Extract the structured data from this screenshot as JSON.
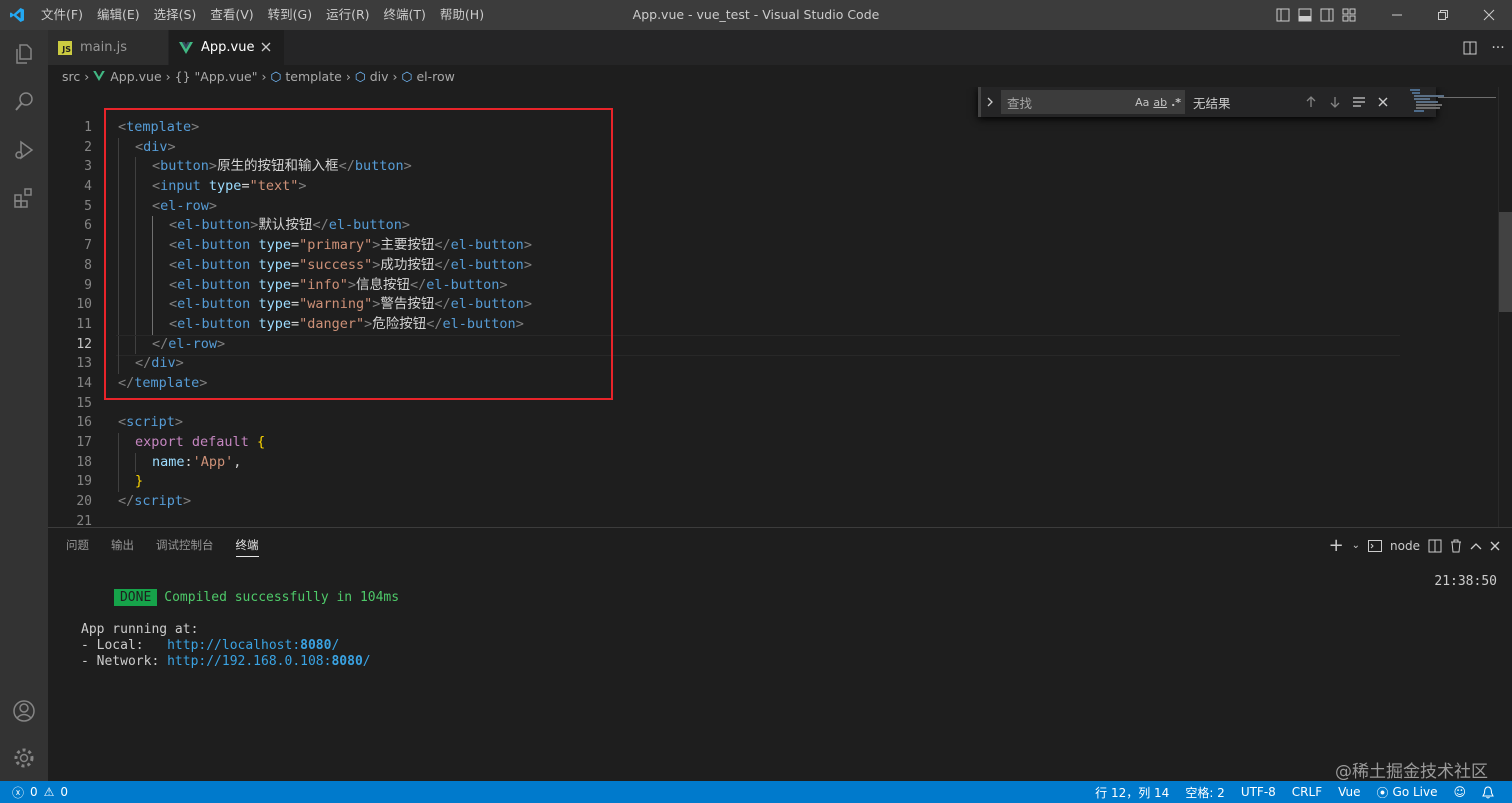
{
  "window": {
    "title": "App.vue - vue_test - Visual Studio Code",
    "menu": [
      "文件(F)",
      "编辑(E)",
      "选择(S)",
      "查看(V)",
      "转到(G)",
      "运行(R)",
      "终端(T)",
      "帮助(H)"
    ]
  },
  "tabs": [
    {
      "label": "main.js",
      "icon": "js-file-icon",
      "icon_text": "JS"
    },
    {
      "label": "App.vue",
      "icon": "vue-file-icon"
    }
  ],
  "breadcrumb": [
    "src",
    "App.vue",
    "{} \"App.vue\"",
    "template",
    "div",
    "el-row"
  ],
  "find": {
    "placeholder": "查找",
    "opt_case": "Aa",
    "opt_word": "ab",
    "opt_regex": ".*",
    "result": "无结果"
  },
  "editor": {
    "current_line": 12,
    "lines": [
      {
        "n": "1",
        "indent": 0,
        "tokens": [
          [
            "br",
            "<"
          ],
          [
            "tag",
            "template"
          ],
          [
            "br",
            ">"
          ]
        ]
      },
      {
        "n": "2",
        "indent": 1,
        "tokens": [
          [
            "br",
            "<"
          ],
          [
            "tag",
            "div"
          ],
          [
            "br",
            ">"
          ]
        ]
      },
      {
        "n": "3",
        "indent": 2,
        "tokens": [
          [
            "br",
            "<"
          ],
          [
            "tag",
            "button"
          ],
          [
            "br",
            ">"
          ],
          [
            "txt",
            "原生的按钮和输入框"
          ],
          [
            "br",
            "</"
          ],
          [
            "tag",
            "button"
          ],
          [
            "br",
            ">"
          ]
        ]
      },
      {
        "n": "4",
        "indent": 2,
        "tokens": [
          [
            "br",
            "<"
          ],
          [
            "tag",
            "input"
          ],
          [
            "txt",
            " "
          ],
          [
            "attr",
            "type"
          ],
          [
            "txt",
            "="
          ],
          [
            "str",
            "\"text\""
          ],
          [
            "br",
            ">"
          ]
        ]
      },
      {
        "n": "5",
        "indent": 2,
        "tokens": [
          [
            "br",
            "<"
          ],
          [
            "tag",
            "el-row"
          ],
          [
            "br",
            ">"
          ]
        ]
      },
      {
        "n": "6",
        "indent": 3,
        "tokens": [
          [
            "br",
            "<"
          ],
          [
            "tag",
            "el-button"
          ],
          [
            "br",
            ">"
          ],
          [
            "txt",
            "默认按钮"
          ],
          [
            "br",
            "</"
          ],
          [
            "tag",
            "el-button"
          ],
          [
            "br",
            ">"
          ]
        ]
      },
      {
        "n": "7",
        "indent": 3,
        "tokens": [
          [
            "br",
            "<"
          ],
          [
            "tag",
            "el-button"
          ],
          [
            "txt",
            " "
          ],
          [
            "attr",
            "type"
          ],
          [
            "txt",
            "="
          ],
          [
            "str",
            "\"primary\""
          ],
          [
            "br",
            ">"
          ],
          [
            "txt",
            "主要按钮"
          ],
          [
            "br",
            "</"
          ],
          [
            "tag",
            "el-button"
          ],
          [
            "br",
            ">"
          ]
        ]
      },
      {
        "n": "8",
        "indent": 3,
        "tokens": [
          [
            "br",
            "<"
          ],
          [
            "tag",
            "el-button"
          ],
          [
            "txt",
            " "
          ],
          [
            "attr",
            "type"
          ],
          [
            "txt",
            "="
          ],
          [
            "str",
            "\"success\""
          ],
          [
            "br",
            ">"
          ],
          [
            "txt",
            "成功按钮"
          ],
          [
            "br",
            "</"
          ],
          [
            "tag",
            "el-button"
          ],
          [
            "br",
            ">"
          ]
        ]
      },
      {
        "n": "9",
        "indent": 3,
        "tokens": [
          [
            "br",
            "<"
          ],
          [
            "tag",
            "el-button"
          ],
          [
            "txt",
            " "
          ],
          [
            "attr",
            "type"
          ],
          [
            "txt",
            "="
          ],
          [
            "str",
            "\"info\""
          ],
          [
            "br",
            ">"
          ],
          [
            "txt",
            "信息按钮"
          ],
          [
            "br",
            "</"
          ],
          [
            "tag",
            "el-button"
          ],
          [
            "br",
            ">"
          ]
        ]
      },
      {
        "n": "10",
        "indent": 3,
        "tokens": [
          [
            "br",
            "<"
          ],
          [
            "tag",
            "el-button"
          ],
          [
            "txt",
            " "
          ],
          [
            "attr",
            "type"
          ],
          [
            "txt",
            "="
          ],
          [
            "str",
            "\"warning\""
          ],
          [
            "br",
            ">"
          ],
          [
            "txt",
            "警告按钮"
          ],
          [
            "br",
            "</"
          ],
          [
            "tag",
            "el-button"
          ],
          [
            "br",
            ">"
          ]
        ]
      },
      {
        "n": "11",
        "indent": 3,
        "tokens": [
          [
            "br",
            "<"
          ],
          [
            "tag",
            "el-button"
          ],
          [
            "txt",
            " "
          ],
          [
            "attr",
            "type"
          ],
          [
            "txt",
            "="
          ],
          [
            "str",
            "\"danger\""
          ],
          [
            "br",
            ">"
          ],
          [
            "txt",
            "危险按钮"
          ],
          [
            "br",
            "</"
          ],
          [
            "tag",
            "el-button"
          ],
          [
            "br",
            ">"
          ]
        ]
      },
      {
        "n": "12",
        "indent": 2,
        "tokens": [
          [
            "br",
            "</"
          ],
          [
            "tag",
            "el-row"
          ],
          [
            "br",
            ">"
          ]
        ]
      },
      {
        "n": "13",
        "indent": 1,
        "tokens": [
          [
            "br",
            "</"
          ],
          [
            "tag",
            "div"
          ],
          [
            "br",
            ">"
          ]
        ]
      },
      {
        "n": "14",
        "indent": 0,
        "tokens": [
          [
            "br",
            "</"
          ],
          [
            "tag",
            "template"
          ],
          [
            "br",
            ">"
          ]
        ]
      },
      {
        "n": "15",
        "indent": 0,
        "tokens": []
      },
      {
        "n": "16",
        "indent": 0,
        "tokens": [
          [
            "br",
            "<"
          ],
          [
            "tag",
            "script"
          ],
          [
            "br",
            ">"
          ]
        ]
      },
      {
        "n": "17",
        "indent": 1,
        "tokens": [
          [
            "kw",
            "export"
          ],
          [
            "txt",
            " "
          ],
          [
            "kw",
            "default"
          ],
          [
            "txt",
            " "
          ],
          [
            "curly",
            "{"
          ]
        ]
      },
      {
        "n": "18",
        "indent": 2,
        "tokens": [
          [
            "attr",
            "name"
          ],
          [
            "txt",
            ":"
          ],
          [
            "str",
            "'App'"
          ],
          [
            "txt",
            ","
          ]
        ]
      },
      {
        "n": "19",
        "indent": 1,
        "tokens": [
          [
            "curly",
            "}"
          ]
        ]
      },
      {
        "n": "20",
        "indent": 0,
        "tokens": [
          [
            "br",
            "</"
          ],
          [
            "tag",
            "script"
          ],
          [
            "br",
            ">"
          ]
        ]
      },
      {
        "n": "21",
        "indent": 0,
        "tokens": []
      }
    ]
  },
  "panel": {
    "tabs": [
      "问题",
      "输出",
      "调试控制台",
      "终端"
    ],
    "active_tab": "终端",
    "shell": "node",
    "terminal": {
      "badge": "DONE",
      "compiled": "Compiled successfully in 104ms",
      "time": "21:38:50",
      "running": "App running at:",
      "local_label": "- Local:   ",
      "local_url_prefix": "http://localhost:",
      "local_port": "8080",
      "local_url_suffix": "/",
      "network_label": "- Network: ",
      "network_url_prefix": "http://192.168.0.108:",
      "network_port": "8080",
      "network_url_suffix": "/"
    }
  },
  "watermark": "@稀土掘金技术社区",
  "statusbar": {
    "errors": "0",
    "warnings": "0",
    "position": "行 12，列 14",
    "spaces": "空格: 2",
    "encoding": "UTF-8",
    "eol": "CRLF",
    "language": "Vue",
    "golive": "Go Live"
  },
  "colors": {
    "statusbar": "#007acc",
    "highlight_box": "#e8242a",
    "tag": "#569cd6",
    "attr": "#9cdcfe",
    "string": "#ce9178"
  }
}
